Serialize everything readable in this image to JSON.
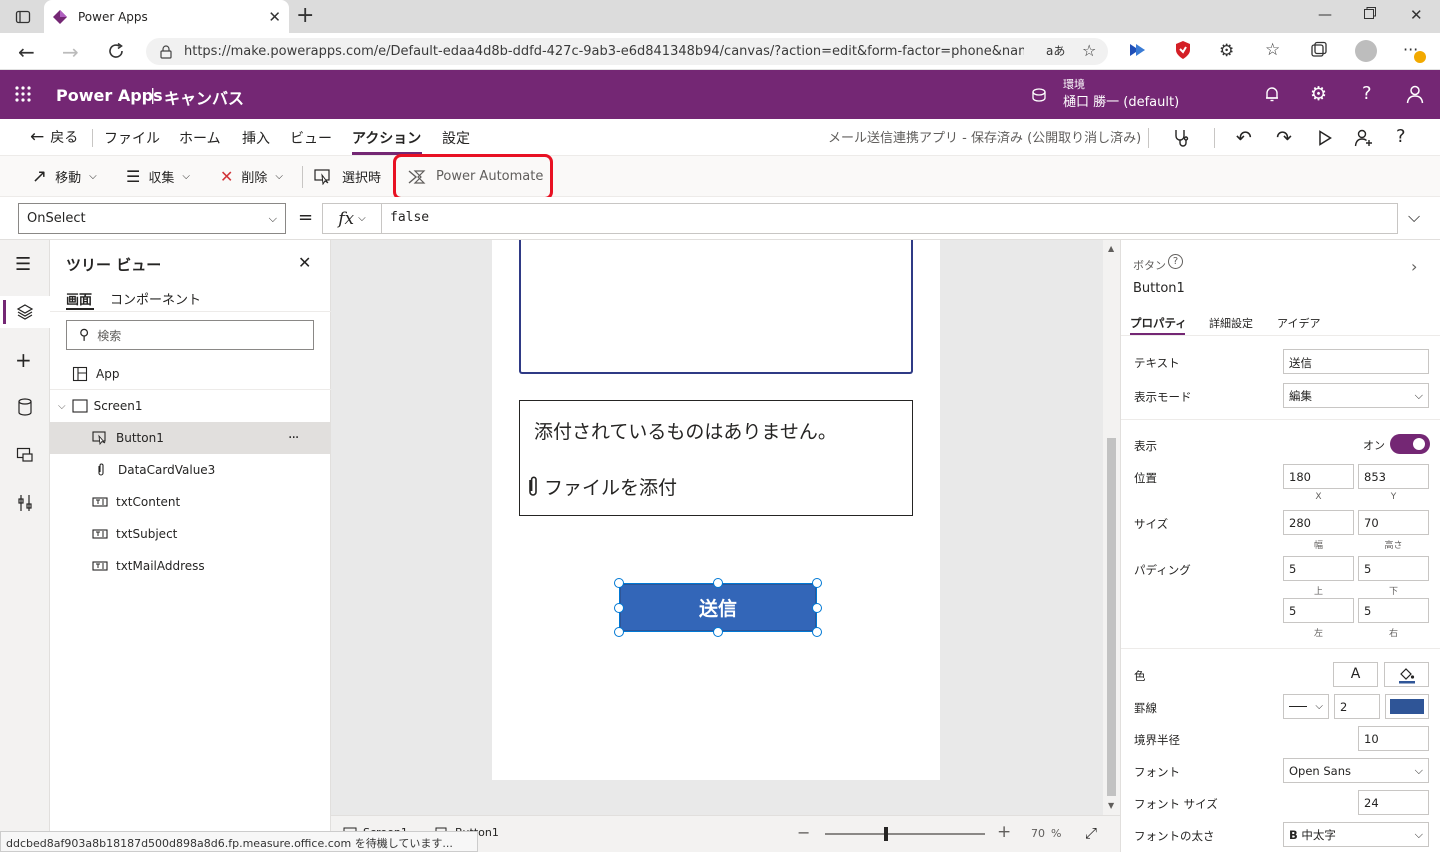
{
  "browser": {
    "tab_title": "Power Apps",
    "url": "https://make.powerapps.com/e/Default-edaa4d8b-ddfd-427c-9ab3-e6d841348b94/canvas/?action=edit&form-factor=phone&name=..."
  },
  "header": {
    "app_name": "Power Apps",
    "separator": "|",
    "mode": "キャンバス",
    "env_label": "環境",
    "env_value": "樋口 勝一 (default)"
  },
  "menubar": {
    "back": "戻る",
    "items": [
      "ファイル",
      "ホーム",
      "挿入",
      "ビュー",
      "アクション",
      "設定"
    ],
    "active": "アクション",
    "status": "メール送信連携アプリ - 保存済み (公開取り消し済み)"
  },
  "ribbon": {
    "move": "移動",
    "collect": "収集",
    "remove": "削除",
    "onselect": "選択時",
    "power_automate": "Power Automate",
    "highlight_color": "#e81123"
  },
  "formula": {
    "property": "OnSelect",
    "equals": "=",
    "fx": "fx",
    "value": "false"
  },
  "tree": {
    "title": "ツリー ビュー",
    "tabs": [
      "画面",
      "コンポーネント"
    ],
    "search_placeholder": "検索",
    "items": [
      "App",
      "Screen1",
      "Button1",
      "DataCardValue3",
      "txtContent",
      "txtSubject",
      "txtMailAddress"
    ],
    "more": "···"
  },
  "canvas": {
    "attach_empty": "添付されているものはありません。",
    "attach_link": "ファイルを添付",
    "send_button": "送信",
    "button_color": "#3366b8"
  },
  "props": {
    "type": "ボタン",
    "name": "Button1",
    "tabs": [
      "プロパティ",
      "詳細設定",
      "アイデア"
    ],
    "text_label": "テキスト",
    "text_value": "送信",
    "display_mode_label": "表示モード",
    "display_mode_value": "編集",
    "visible_label": "表示",
    "visible_state": "オン",
    "position_label": "位置",
    "x": "180",
    "y": "853",
    "x_sub": "X",
    "y_sub": "Y",
    "size_label": "サイズ",
    "width": "280",
    "height": "70",
    "width_sub": "幅",
    "height_sub": "高さ",
    "padding_label": "パディング",
    "pad_top": "5",
    "pad_bottom": "5",
    "pad_left": "5",
    "pad_right": "5",
    "pad_top_sub": "上",
    "pad_bottom_sub": "下",
    "pad_left_sub": "左",
    "pad_right_sub": "右",
    "color_label": "色",
    "color_letter": "A",
    "border_label": "罫線",
    "border_width": "2",
    "border_color": "#2f5597",
    "radius_label": "境界半径",
    "radius_value": "10",
    "font_label": "フォント",
    "font_value": "Open Sans",
    "font_size_label": "フォント サイズ",
    "font_size_value": "24",
    "font_weight_label": "フォントの太さ",
    "font_weight_value": "中太字",
    "font_weight_glyph": "B"
  },
  "statusbar": {
    "screen": "Screen1",
    "button": "Button1",
    "zoom": "70",
    "percent": "%",
    "minus": "−",
    "plus": "+"
  },
  "tooltip": "ddcbed8af903a8b18187d500d898a8d6.fp.measure.office.com を待機しています..."
}
